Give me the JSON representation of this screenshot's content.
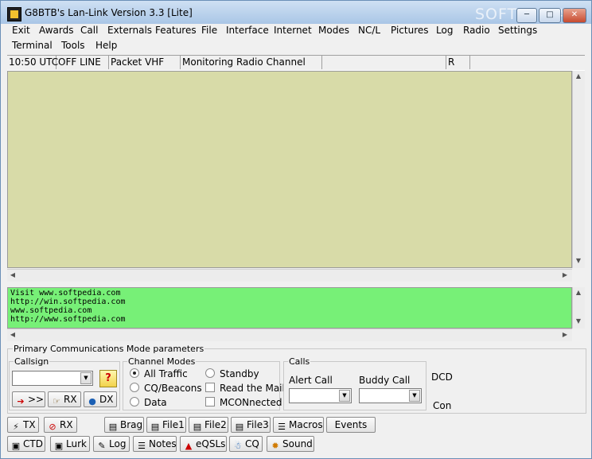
{
  "title": "G8BTB's Lan-Link Version 3.3 [Lite]",
  "watermark": "SOFTPEDIA",
  "window_buttons": [
    "minimize-icon",
    "maximize-icon",
    "close-icon"
  ],
  "menu_row1": [
    "Exit",
    "Awards",
    "Call",
    "Externals",
    "Features",
    "File",
    "Interface",
    "Internet",
    "Modes",
    "NC/L",
    "Pictures",
    "Log",
    "Radio",
    "Settings"
  ],
  "menu_row2": [
    "Terminal",
    "Tools",
    "Help"
  ],
  "status": {
    "time": "10:50 UTC",
    "line": "OFF LINE",
    "mode": "Packet VHF",
    "activity": "Monitoring Radio Channel",
    "indicator": "R"
  },
  "text_lines": [
    "Visit www.softpedia.com",
    "http://win.softpedia.com",
    "www.softpedia.com",
    "http://www.softpedia.com"
  ],
  "primary_group_label": "Primary Communications Mode parameters",
  "callsign": {
    "label": "Callsign",
    "value": "",
    "send_label": ">>",
    "rx_label": "RX",
    "dx_label": "DX"
  },
  "channel_modes": {
    "label": "Channel Modes",
    "options": [
      "All Traffic",
      "CQ/Beacons",
      "Data"
    ],
    "selected": "All Traffic",
    "options_right": [
      "Standby",
      "Read the Mail",
      "MCONnected"
    ]
  },
  "calls": {
    "label": "Calls",
    "alert_label": "Alert Call",
    "buddy_label": "Buddy Call"
  },
  "side_labels": {
    "dcd": "DCD",
    "con": "Con"
  },
  "toolbar_row1": {
    "tx": "TX",
    "rx": "RX",
    "brag": "Brag",
    "file1": "File1",
    "file2": "File2",
    "file3": "File3",
    "macros": "Macros",
    "events": "Events"
  },
  "toolbar_row2": {
    "ctd": "CTD",
    "lurk": "Lurk",
    "log": "Log",
    "notes": "Notes",
    "eqsls": "eQSLs",
    "cq": "CQ",
    "sound": "Sound"
  },
  "colors": {
    "monitor_bg": "#d8dba8",
    "text_bg": "#77f077",
    "titlebar": "#a9c6e6"
  }
}
